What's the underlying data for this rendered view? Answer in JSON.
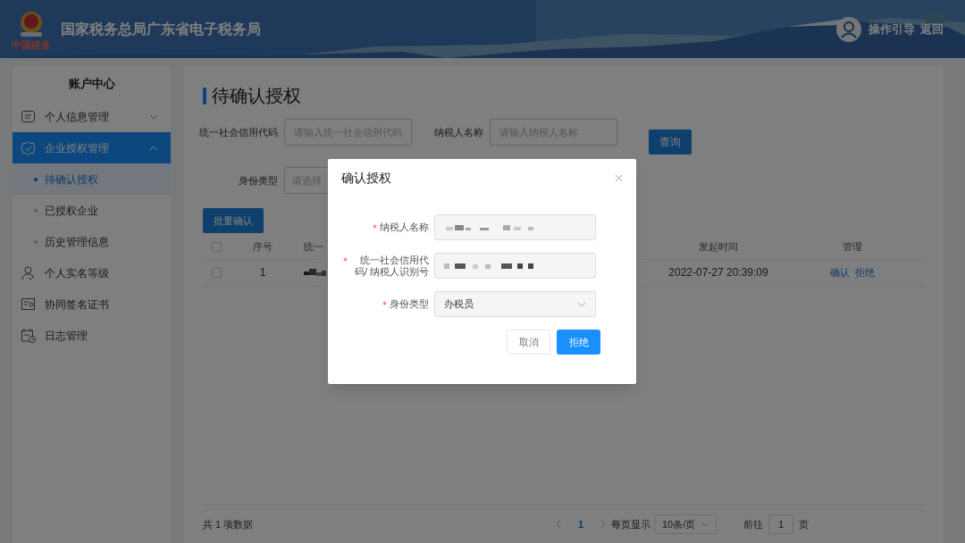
{
  "header": {
    "logo_caption": "中国税务",
    "title": "国家税务总局广东省电子税务局",
    "links": [
      "操作引导",
      "返回"
    ]
  },
  "sidebar": {
    "title": "账户中心",
    "items": [
      {
        "label": "个人信息管理",
        "selected": false,
        "expanded": false
      },
      {
        "label": "企业授权管理",
        "selected": true,
        "expanded": true,
        "children": [
          {
            "label": "待确认授权",
            "selected": true
          },
          {
            "label": "已授权企业",
            "selected": false
          },
          {
            "label": "历史管理信息",
            "selected": false
          }
        ]
      },
      {
        "label": "个人实名等级",
        "selected": false
      },
      {
        "label": "协同签名证书",
        "selected": false
      },
      {
        "label": "日志管理",
        "selected": false
      }
    ]
  },
  "page_title": "待确认授权",
  "filters": [
    {
      "label": "统一社会信用代码",
      "placeholder": "请输入统一社会信用代码",
      "kind": "input"
    },
    {
      "label": "纳税人名称",
      "placeholder": "请输入纳税人名称",
      "kind": "input"
    },
    {
      "label": "身份类型",
      "placeholder": "请选择",
      "kind": "select"
    }
  ],
  "query_button": "查询",
  "batch_button": "批量确认",
  "table": {
    "header_checked": false,
    "columns": [
      "序号",
      "统一",
      "发起时间",
      "管理"
    ],
    "rows": [
      {
        "checked": false,
        "index": "1",
        "time": "2022-07-27 20:39:09",
        "actions": [
          "确认",
          "拒绝"
        ]
      }
    ]
  },
  "pagination": {
    "total": "共 1 项数据",
    "pages": [
      {
        "label": "1",
        "selected": true
      }
    ],
    "page_size_label": "每页显示",
    "page_size": "10条/页",
    "goto_label": "前往",
    "goto_value": "1",
    "goto_suffix": "页"
  },
  "dialog": {
    "title": "确认授权",
    "fields": [
      {
        "label": "纳税人名称",
        "required": true,
        "kind": "masked"
      },
      {
        "label": "统一社会信用代码/ 纳税人识别号",
        "required": true,
        "kind": "masked"
      },
      {
        "label": "身份类型",
        "required": true,
        "kind": "select",
        "value": "办税员"
      }
    ],
    "buttons": [
      {
        "label": "取消",
        "primary": false
      },
      {
        "label": "拒绝",
        "primary": true
      }
    ]
  }
}
